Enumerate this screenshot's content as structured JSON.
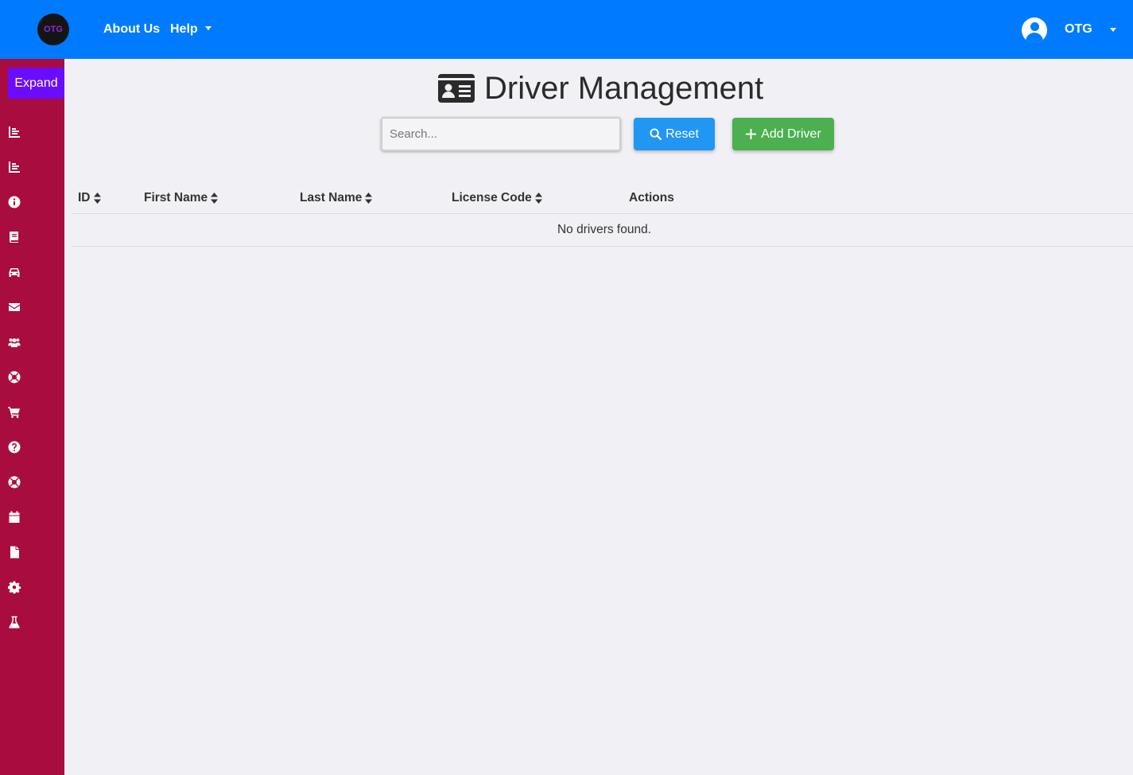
{
  "navbar": {
    "logo_text": "OTG",
    "links": [
      {
        "label": "About Us"
      },
      {
        "label": "Help"
      }
    ],
    "user": {
      "name": "OTG"
    },
    "bg_color": "#007bff"
  },
  "sidebar": {
    "expand_label": "Expand",
    "bg_color": "#a90c3f",
    "icons": [
      "chart-bar-icon",
      "chart-bar-icon",
      "info-circle-icon",
      "book-icon",
      "car-icon",
      "envelope-icon",
      "users-icon",
      "life-ring-icon",
      "shopping-cart-icon",
      "question-circle-icon",
      "life-ring-icon",
      "calendar-icon",
      "file-icon",
      "gear-icon",
      "flask-icon"
    ]
  },
  "main": {
    "title": "Driver Management",
    "title_icon": "id-card-icon",
    "search": {
      "placeholder": "Search...",
      "value": ""
    },
    "reset_label": "Reset",
    "add_label": "Add Driver",
    "table": {
      "columns": [
        {
          "label": "ID",
          "sortable": true
        },
        {
          "label": "First Name",
          "sortable": true
        },
        {
          "label": "Last Name",
          "sortable": true
        },
        {
          "label": "License Code",
          "sortable": true
        },
        {
          "label": "Actions",
          "sortable": false
        }
      ],
      "rows": [],
      "empty_message": "No drivers found."
    }
  }
}
